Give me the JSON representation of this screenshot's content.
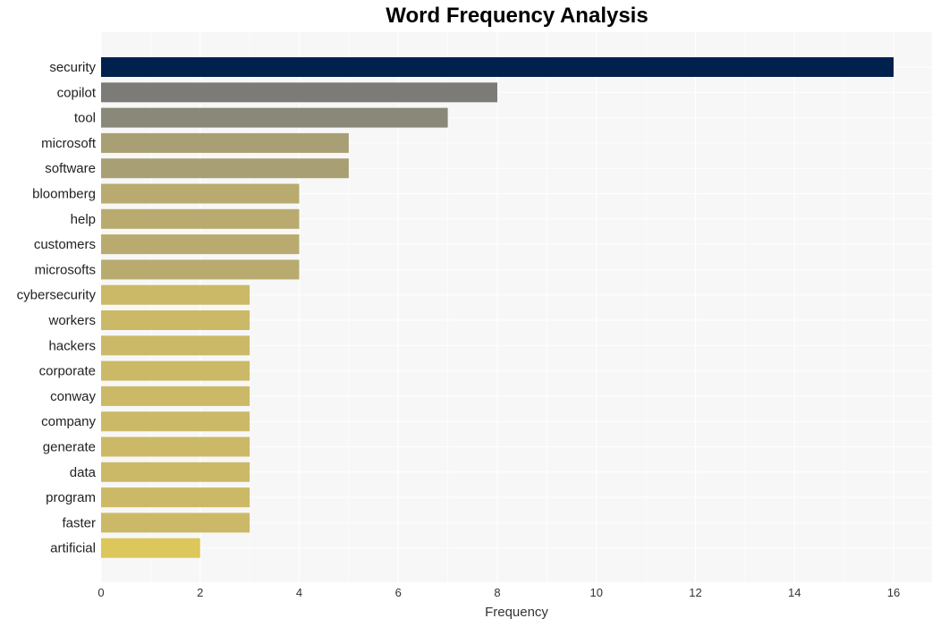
{
  "chart_data": {
    "type": "bar",
    "orientation": "horizontal",
    "title": "Word Frequency Analysis",
    "xlabel": "Frequency",
    "ylabel": "",
    "xlim": [
      0,
      16.8
    ],
    "xticks": [
      0,
      2,
      4,
      6,
      8,
      10,
      12,
      14,
      16
    ],
    "grid": true,
    "legend": "none",
    "categories": [
      "security",
      "copilot",
      "tool",
      "microsoft",
      "software",
      "bloomberg",
      "help",
      "customers",
      "microsofts",
      "cybersecurity",
      "workers",
      "hackers",
      "corporate",
      "conway",
      "company",
      "generate",
      "data",
      "program",
      "faster",
      "artificial"
    ],
    "values": [
      16,
      8,
      7,
      5,
      5,
      4,
      4,
      4,
      4,
      3,
      3,
      3,
      3,
      3,
      3,
      3,
      3,
      3,
      3,
      2
    ],
    "colors": [
      "#00204e",
      "#7c7b78",
      "#8a8878",
      "#a89f74",
      "#a89f74",
      "#b9ab6f",
      "#b9ab6f",
      "#b9ab6f",
      "#b9ab6f",
      "#cbb967",
      "#cbb967",
      "#cbb967",
      "#cbb967",
      "#cbb967",
      "#cbb967",
      "#cbb967",
      "#cbb967",
      "#cbb967",
      "#cbb967",
      "#dcc75a"
    ]
  },
  "colors": {
    "plot_background": "#f7f7f7",
    "grid": "#ffffff",
    "page_background": "#ffffff"
  }
}
